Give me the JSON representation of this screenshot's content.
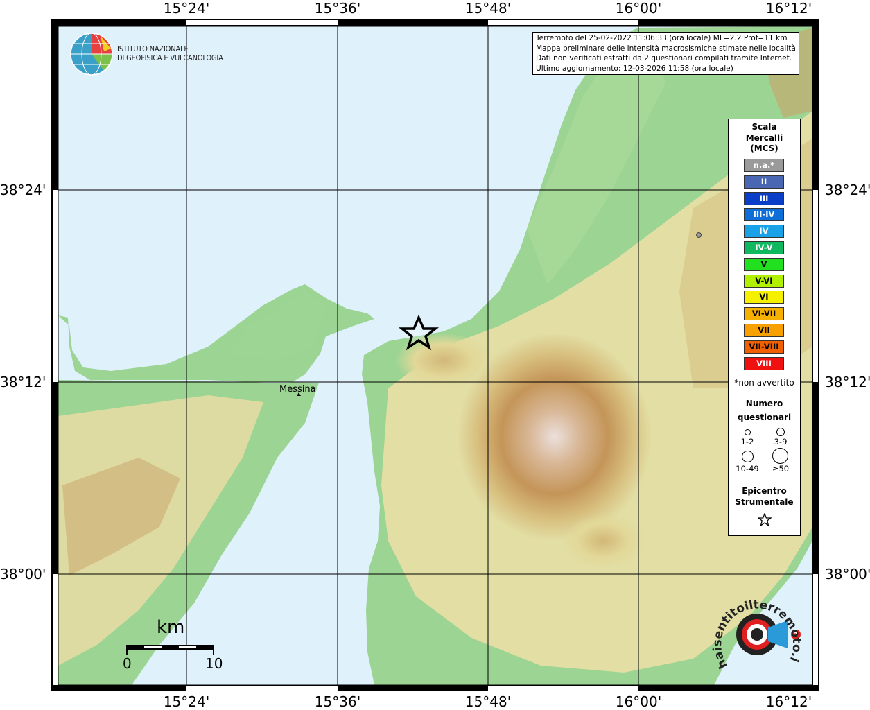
{
  "map": {
    "grid_lon_labels": [
      "15°24'",
      "15°36'",
      "15°48'",
      "16°00'",
      "16°12'"
    ],
    "grid_lat_labels": [
      "38°24'",
      "38°12'",
      "38°00'"
    ],
    "city": "Messina",
    "colors": {
      "sea": "#dff1fb",
      "lowland": "#8ccf8a",
      "hills": "#e8e0a8",
      "mountain": "#b88a4e",
      "peak": "#e6d8d2"
    }
  },
  "logo": {
    "line1": "ISTITUTO NAZIONALE",
    "line2": "DI GEOFISICA E VULCANOLOGIA",
    "icon": "ingv-globe-icon"
  },
  "info": {
    "line1": "Terremoto del 25-02-2022 11:06:33 (ora locale) ML=2.2 Prof=11 km",
    "line2": "Mappa preliminare delle intensità macrosismiche stimate nelle località",
    "line3": "Dati non verificati estratti da 2 questionari compilati tramite Internet.",
    "line4": "Ultimo aggiornamento: 12-03-2026 11:58 (ora locale)"
  },
  "legend": {
    "title1": "Scala",
    "title2": "Mercalli",
    "title3": "(MCS)",
    "items": [
      {
        "label": "n.a.*",
        "color": "#9a9a9a"
      },
      {
        "label": "II",
        "color": "#4a67b4"
      },
      {
        "label": "III",
        "color": "#0a3ec8"
      },
      {
        "label": "III-IV",
        "color": "#0f6fd8"
      },
      {
        "label": "IV",
        "color": "#1aa2e8"
      },
      {
        "label": "IV-V",
        "color": "#10b860"
      },
      {
        "label": "V",
        "color": "#20e020"
      },
      {
        "label": "V-VI",
        "color": "#b0f000"
      },
      {
        "label": "VI",
        "color": "#f5f000"
      },
      {
        "label": "VI-VII",
        "color": "#f5b000"
      },
      {
        "label": "VII",
        "color": "#f8a000"
      },
      {
        "label": "VII-VIII",
        "color": "#f06000"
      },
      {
        "label": "VIII",
        "color": "#f01010"
      }
    ],
    "note": "*non avvertito",
    "questionnaire_title1": "Numero",
    "questionnaire_title2": "questionari",
    "q_labels": [
      "1-2",
      "3-9",
      "10-49",
      "≥50"
    ],
    "epicenter_title1": "Epicentro",
    "epicenter_title2": "Strumentale"
  },
  "scale_bar": {
    "title": "km",
    "min": "0",
    "max": "10"
  },
  "watermark": {
    "text": "haisentitoilterremoto.it",
    "icon": "megaphone-target-icon"
  }
}
